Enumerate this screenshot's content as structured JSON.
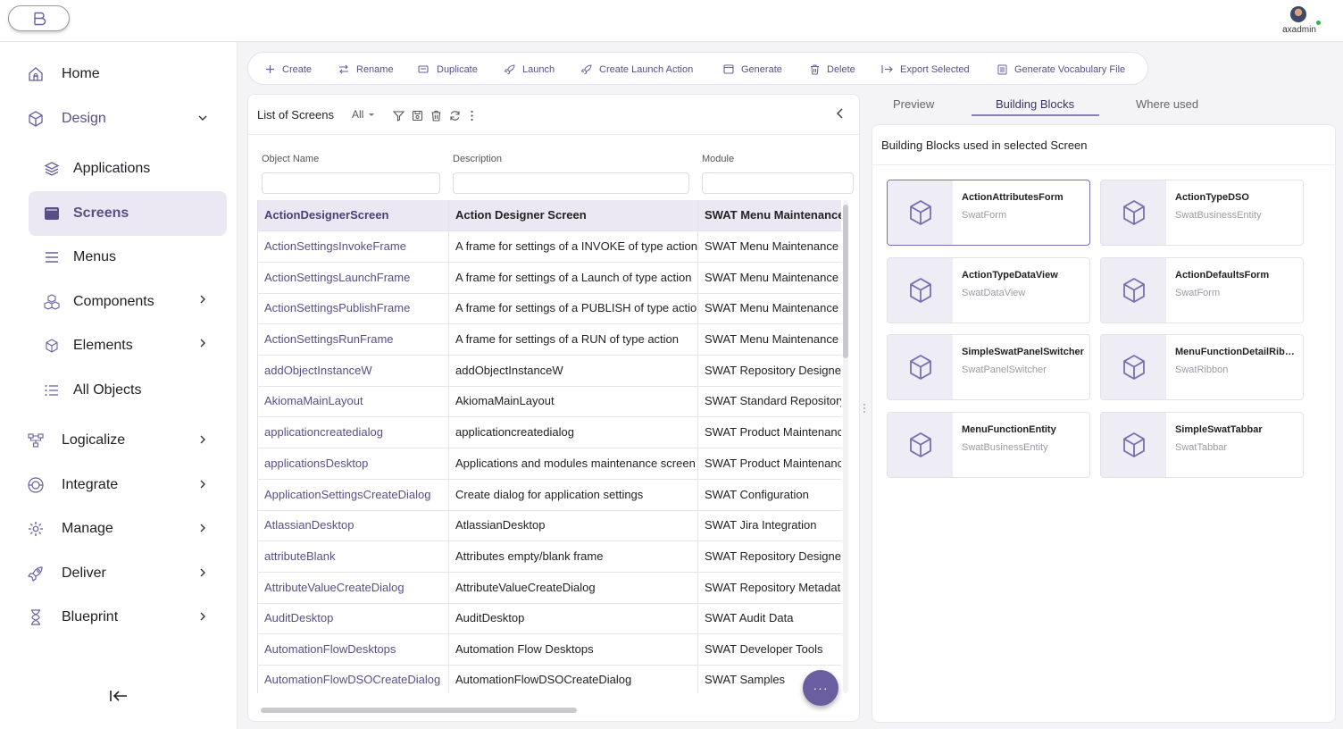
{
  "topbar": {
    "username": "axadmin"
  },
  "sidebar": {
    "items": [
      {
        "label": "Home",
        "icon": "home-icon"
      },
      {
        "label": "Design",
        "icon": "cube-icon"
      },
      {
        "label": "Applications",
        "icon": "layers-icon"
      },
      {
        "label": "Screens",
        "icon": "screen-icon"
      },
      {
        "label": "Menus",
        "icon": "menu-icon"
      },
      {
        "label": "Components",
        "icon": "components-icon"
      },
      {
        "label": "Elements",
        "icon": "element-icon"
      },
      {
        "label": "All Objects",
        "icon": "list-icon"
      },
      {
        "label": "Logicalize",
        "icon": "flow-icon"
      },
      {
        "label": "Integrate",
        "icon": "integrate-icon"
      },
      {
        "label": "Manage",
        "icon": "gear-icon"
      },
      {
        "label": "Deliver",
        "icon": "rocket-icon"
      },
      {
        "label": "Blueprint",
        "icon": "hourglass-icon"
      }
    ]
  },
  "toolbar": {
    "buttons": [
      {
        "label": "Create",
        "icon": "plus-icon"
      },
      {
        "label": "Rename",
        "icon": "swap-icon"
      },
      {
        "label": "Duplicate",
        "icon": "duplicate-icon"
      },
      {
        "label": "Launch",
        "icon": "launch-icon"
      },
      {
        "label": "Create Launch Action",
        "icon": "launch-action-icon"
      },
      {
        "label": "Generate",
        "icon": "window-icon"
      },
      {
        "label": "Delete",
        "icon": "trash-icon"
      },
      {
        "label": "Export Selected",
        "icon": "export-icon"
      },
      {
        "label": "Generate Vocabulary File",
        "icon": "file-icon"
      }
    ]
  },
  "list": {
    "title": "List of Screens",
    "filter": "All",
    "columns": [
      "Object Name",
      "Description",
      "Module"
    ],
    "rows": [
      [
        "ActionDesignerScreen",
        "Action Designer Screen",
        "SWAT Menu Maintenance"
      ],
      [
        "ActionSettingsInvokeFrame",
        "A frame for settings of a INVOKE of type action",
        "SWAT Menu Maintenance"
      ],
      [
        "ActionSettingsLaunchFrame",
        "A frame for settings of a Launch of type action",
        "SWAT Menu Maintenance"
      ],
      [
        "ActionSettingsPublishFrame",
        "A frame for settings of a PUBLISH of type action",
        "SWAT Menu Maintenance"
      ],
      [
        "ActionSettingsRunFrame",
        "A frame for settings of a RUN of type action",
        "SWAT Menu Maintenance"
      ],
      [
        "addObjectInstanceW",
        "addObjectInstanceW",
        "SWAT Repository Designer"
      ],
      [
        "AkiomaMainLayout",
        "AkiomaMainLayout",
        "SWAT Standard Repository"
      ],
      [
        "applicationcreatedialog",
        "applicationcreatedialog",
        "SWAT Product Maintenance"
      ],
      [
        "applicationsDesktop",
        "Applications and modules maintenance screen",
        "SWAT Product Maintenance"
      ],
      [
        "ApplicationSettingsCreateDialog",
        "Create dialog for application settings",
        "SWAT Configuration"
      ],
      [
        "AtlassianDesktop",
        "AtlassianDesktop",
        "SWAT Jira Integration"
      ],
      [
        "attributeBlank",
        "Attributes empty/blank frame",
        "SWAT Repository Designer"
      ],
      [
        "AttributeValueCreateDialog",
        "AttributeValueCreateDialog",
        "SWAT Repository Metadata"
      ],
      [
        "AuditDesktop",
        "AuditDesktop",
        "SWAT Audit Data"
      ],
      [
        "AutomationFlowDesktops",
        "Automation Flow Desktops",
        "SWAT Developer Tools"
      ],
      [
        "AutomationFlowDSOCreateDialog",
        "AutomationFlowDSOCreateDialog",
        "SWAT Samples"
      ]
    ]
  },
  "right_panel": {
    "tabs": [
      "Preview",
      "Building Blocks",
      "Where used"
    ],
    "active_tab": "Building Blocks",
    "title": "Building Blocks used in selected Screen",
    "blocks": [
      {
        "name": "ActionAttributesForm",
        "type": "SwatForm"
      },
      {
        "name": "ActionTypeDSO",
        "type": "SwatBusinessEntity"
      },
      {
        "name": "ActionTypeDataView",
        "type": "SwatDataView"
      },
      {
        "name": "ActionDefaultsForm",
        "type": "SwatForm"
      },
      {
        "name": "SimpleSwatPanelSwitcher",
        "type": "SwatPanelSwitcher"
      },
      {
        "name": "MenuFunctionDetailRibbon",
        "type": "SwatRibbon"
      },
      {
        "name": "MenuFunctionEntity",
        "type": "SwatBusinessEntity"
      },
      {
        "name": "SimpleSwatTabbar",
        "type": "SwatTabbar"
      }
    ]
  },
  "fab": {
    "label": "···"
  },
  "colors": {
    "accent": "#5b4e86",
    "selected_bg": "#ece8f3",
    "fab": "#6a5ea0"
  }
}
